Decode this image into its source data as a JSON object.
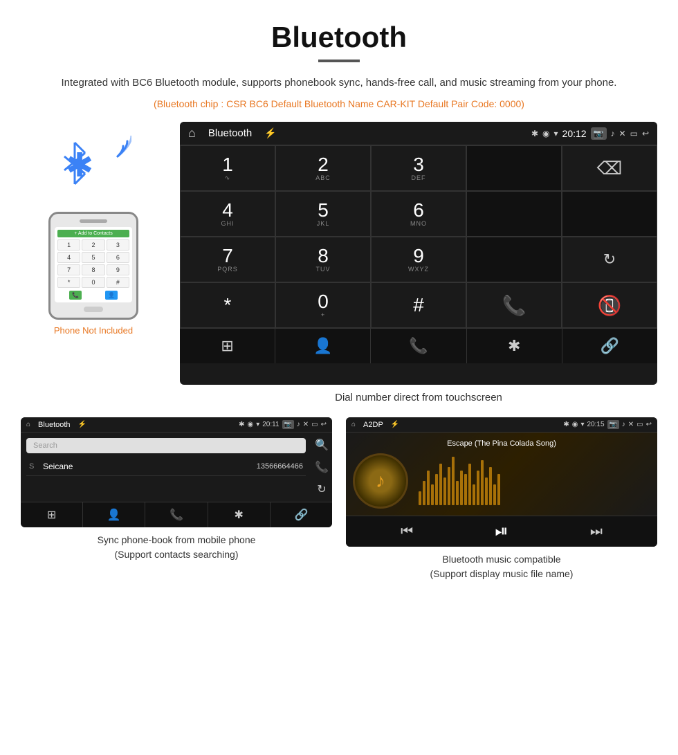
{
  "page": {
    "title": "Bluetooth",
    "subtitle": "Integrated with BC6 Bluetooth module, supports phonebook sync, hands-free call, and music streaming from your phone.",
    "info_line": "(Bluetooth chip : CSR BC6    Default Bluetooth Name CAR-KIT    Default Pair Code: 0000)",
    "dial_caption": "Dial number direct from touchscreen",
    "bottom_left_caption": "Sync phone-book from mobile phone\n(Support contacts searching)",
    "bottom_right_caption": "Bluetooth music compatible\n(Support display music file name)",
    "phone_not_included": "Phone Not Included"
  },
  "car_screen": {
    "title": "Bluetooth",
    "time": "20:12",
    "keys": [
      {
        "num": "1",
        "sub": ""
      },
      {
        "num": "2",
        "sub": "ABC"
      },
      {
        "num": "3",
        "sub": "DEF"
      },
      {
        "num": "",
        "sub": ""
      },
      {
        "num": "⌫",
        "sub": ""
      },
      {
        "num": "4",
        "sub": "GHI"
      },
      {
        "num": "5",
        "sub": "JKL"
      },
      {
        "num": "6",
        "sub": "MNO"
      },
      {
        "num": "",
        "sub": ""
      },
      {
        "num": "",
        "sub": ""
      },
      {
        "num": "7",
        "sub": "PQRS"
      },
      {
        "num": "8",
        "sub": "TUV"
      },
      {
        "num": "9",
        "sub": "WXYZ"
      },
      {
        "num": "",
        "sub": ""
      },
      {
        "num": "↻",
        "sub": ""
      },
      {
        "num": "*",
        "sub": ""
      },
      {
        "num": "0",
        "sub": "+"
      },
      {
        "num": "#",
        "sub": ""
      },
      {
        "num": "📞",
        "sub": "green"
      },
      {
        "num": "📵",
        "sub": "red"
      }
    ]
  },
  "phonebook_screen": {
    "title": "Bluetooth",
    "time": "20:11",
    "search_placeholder": "Search",
    "contact": {
      "letter": "S",
      "name": "Seicane",
      "number": "13566664466"
    }
  },
  "music_screen": {
    "title": "A2DP",
    "time": "20:15",
    "song_title": "Escape (The Pina Colada Song)",
    "viz_heights": [
      20,
      35,
      50,
      30,
      45,
      60,
      40,
      55,
      70,
      35,
      50,
      45,
      60,
      30,
      50,
      65,
      40,
      55,
      30,
      45
    ]
  },
  "icons": {
    "home": "⌂",
    "usb": "⚡",
    "bluetooth": "✱",
    "location": "◉",
    "wifi": "▾",
    "camera": "📷",
    "volume": "♪",
    "close_x": "✕",
    "window": "▭",
    "back": "↩",
    "grid": "⊞",
    "person": "👤",
    "phone": "📞",
    "link": "🔗",
    "search": "🔍",
    "refresh": "↻",
    "prev": "⏮",
    "playpause": "⏯",
    "next": "⏭",
    "music_note": "♪",
    "contact_icon": "👤"
  }
}
